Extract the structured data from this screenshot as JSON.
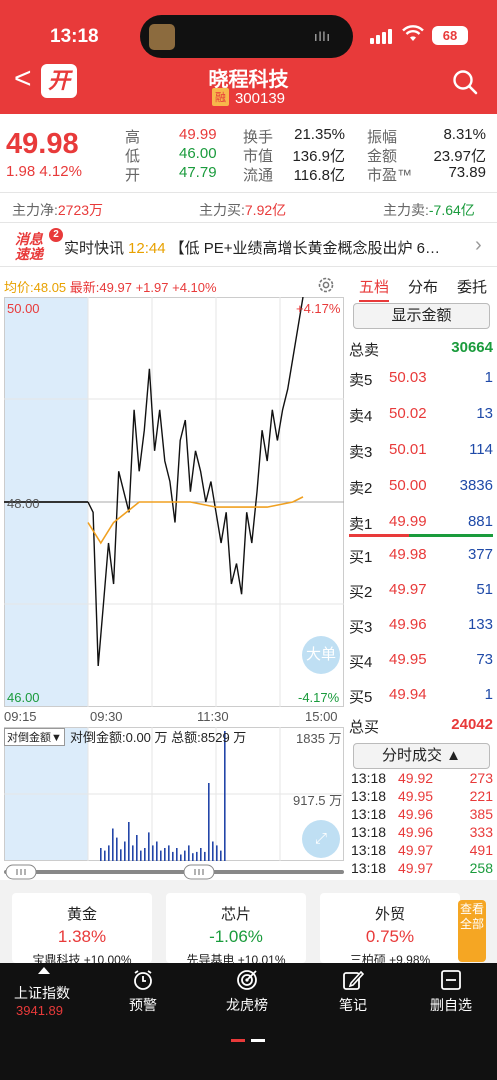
{
  "status": {
    "time": "13:18",
    "battery": "68"
  },
  "header": {
    "open_badge": "开",
    "title": "晓程科技",
    "badge": "融",
    "code": "300139"
  },
  "quote": {
    "price": "49.98",
    "change": "1.98",
    "change_pct": "4.12%",
    "high_label": "高",
    "high": "49.99",
    "low_label": "低",
    "low": "46.00",
    "open_label": "开",
    "open": "47.79",
    "turnover_label": "换手",
    "turnover": "21.35%",
    "mktcap_label": "市值",
    "mktcap": "136.9亿",
    "float_label": "流通",
    "float": "116.8亿",
    "amplitude_label": "振幅",
    "amplitude": "8.31%",
    "amount_label": "金额",
    "amount": "23.97亿",
    "pe_label": "市盈™",
    "pe": "73.89"
  },
  "flows": {
    "net_label": "主力净:",
    "net": "2723万",
    "buy_label": "主力买:",
    "buy": "7.92亿",
    "sell_label": "主力卖:",
    "sell": "-7.64亿"
  },
  "news": {
    "logo_top": "消息",
    "logo_bottom": "速递",
    "count": "2",
    "label": "实时快讯",
    "time": "12:44",
    "text": "【低 PE+业绩高增长黄金概念股出炉 6…"
  },
  "chart": {
    "avg_label": "均价:",
    "avg": "48.05",
    "latest_label": "最新:",
    "latest": "49.97",
    "latest_chg": "+1.97",
    "latest_pct": "+4.10%",
    "price_top": "50.00",
    "price_mid": "48.00",
    "price_bottom": "46.00",
    "pct_top": "+4.17%",
    "pct_bottom": "-4.17%",
    "time_labels": [
      "09:15",
      "09:30",
      "11:30",
      "15:00"
    ],
    "big_order_btn": "大单",
    "vol_tab": "对倒金额▼",
    "vol_info": "对倒金额:0.00 万 总额:8529 万",
    "vol_top": "1835 万",
    "vol_mid": "917.5 万"
  },
  "chart_data": {
    "type": "line",
    "x_range": [
      "09:15",
      "15:00"
    ],
    "ylim": [
      46.0,
      50.0
    ],
    "prev_close": 48.0,
    "series": [
      {
        "name": "最新",
        "color": "#111111",
        "points": [
          [
            0,
            48.0
          ],
          [
            0.02,
            47.9
          ],
          [
            0.04,
            46.4
          ],
          [
            0.06,
            47.0
          ],
          [
            0.08,
            47.6
          ],
          [
            0.1,
            47.2
          ],
          [
            0.12,
            48.3
          ],
          [
            0.14,
            48.1
          ],
          [
            0.16,
            47.9
          ],
          [
            0.18,
            48.9
          ],
          [
            0.2,
            48.3
          ],
          [
            0.22,
            48.7
          ],
          [
            0.24,
            49.3
          ],
          [
            0.26,
            48.5
          ],
          [
            0.28,
            48.9
          ],
          [
            0.3,
            48.4
          ],
          [
            0.32,
            48.2
          ],
          [
            0.34,
            47.8
          ],
          [
            0.36,
            48.6
          ],
          [
            0.38,
            48.8
          ],
          [
            0.4,
            48.1
          ],
          [
            0.42,
            48.5
          ],
          [
            0.44,
            48.3
          ],
          [
            0.46,
            48.0
          ],
          [
            0.48,
            48.2
          ],
          [
            0.5,
            47.9
          ],
          [
            0.52,
            47.6
          ],
          [
            0.54,
            47.9
          ],
          [
            0.56,
            47.2
          ],
          [
            0.58,
            47.4
          ],
          [
            0.6,
            47.1
          ],
          [
            0.62,
            47.9
          ],
          [
            0.64,
            47.6
          ],
          [
            0.66,
            48.1
          ],
          [
            0.68,
            48.7
          ],
          [
            0.7,
            48.4
          ],
          [
            0.72,
            48.9
          ],
          [
            0.74,
            48.6
          ],
          [
            0.76,
            48.9
          ],
          [
            0.78,
            49.1
          ],
          [
            0.8,
            49.4
          ],
          [
            0.82,
            49.7
          ],
          [
            0.84,
            50.0
          ]
        ]
      },
      {
        "name": "均价",
        "color": "#f0a020",
        "points": [
          [
            0,
            47.8
          ],
          [
            0.05,
            47.6
          ],
          [
            0.1,
            47.8
          ],
          [
            0.15,
            47.9
          ],
          [
            0.2,
            48.0
          ],
          [
            0.3,
            48.0
          ],
          [
            0.4,
            48.0
          ],
          [
            0.5,
            47.95
          ],
          [
            0.6,
            47.95
          ],
          [
            0.7,
            47.95
          ],
          [
            0.8,
            48.0
          ],
          [
            0.84,
            48.05
          ]
        ]
      }
    ],
    "volume": [
      0,
      0,
      0.1,
      0.08,
      0.12,
      0.25,
      0.18,
      0.09,
      0.15,
      0.3,
      0.12,
      0.2,
      0.08,
      0.1,
      0.22,
      0.12,
      0.15,
      0.08,
      0.1,
      0.12,
      0.07,
      0.1,
      0.05,
      0.08,
      0.12,
      0.06,
      0.07,
      0.1,
      0.07,
      0.6,
      0.15,
      0.12,
      0.08,
      1.0
    ]
  },
  "orderbook": {
    "tabs": [
      "五档",
      "分布",
      "委托"
    ],
    "show_amount_btn": "显示金额",
    "total_sell_label": "总卖",
    "total_sell": "30664",
    "asks": [
      {
        "name": "卖5",
        "price": "50.03",
        "vol": "1"
      },
      {
        "name": "卖4",
        "price": "50.02",
        "vol": "13"
      },
      {
        "name": "卖3",
        "price": "50.01",
        "vol": "114"
      },
      {
        "name": "卖2",
        "price": "50.00",
        "vol": "3836"
      },
      {
        "name": "卖1",
        "price": "49.99",
        "vol": "881"
      }
    ],
    "bids": [
      {
        "name": "买1",
        "price": "49.98",
        "vol": "377"
      },
      {
        "name": "买2",
        "price": "49.97",
        "vol": "51"
      },
      {
        "name": "买3",
        "price": "49.96",
        "vol": "133"
      },
      {
        "name": "买4",
        "price": "49.95",
        "vol": "73"
      },
      {
        "name": "买5",
        "price": "49.94",
        "vol": "1"
      }
    ],
    "total_buy_label": "总买",
    "total_buy": "24042",
    "deals_btn": "分时成交 ▲",
    "deals": [
      {
        "time": "13:18",
        "price": "49.92",
        "vol": "273",
        "dir": "up"
      },
      {
        "time": "13:18",
        "price": "49.95",
        "vol": "221",
        "dir": "up"
      },
      {
        "time": "13:18",
        "price": "49.96",
        "vol": "385",
        "dir": "up"
      },
      {
        "time": "13:18",
        "price": "49.96",
        "vol": "333",
        "dir": "up"
      },
      {
        "time": "13:18",
        "price": "49.97",
        "vol": "491",
        "dir": "up"
      },
      {
        "time": "13:18",
        "price": "49.97",
        "vol": "258",
        "dir": "down"
      }
    ]
  },
  "sectors": [
    {
      "name": "黄金",
      "pct": "1.38%",
      "stock": "宝鼎科技 +10.00%",
      "dir": "up"
    },
    {
      "name": "芯片",
      "pct": "-1.06%",
      "stock": "先导基电 +10.01%",
      "dir": "down"
    },
    {
      "name": "外贸",
      "pct": "0.75%",
      "stock": "三柏硕 +9.98%",
      "dir": "up"
    }
  ],
  "sectors_more": "查看全部",
  "bottom_bar": {
    "index_name": "上证指数",
    "index_value": "3941.89",
    "items": [
      {
        "label": "预警",
        "icon": "alarm-clock-icon"
      },
      {
        "label": "龙虎榜",
        "icon": "target-icon"
      },
      {
        "label": "笔记",
        "icon": "edit-icon"
      },
      {
        "label": "删自选",
        "icon": "minus-square-icon"
      }
    ]
  },
  "colors": {
    "accent": "#e83a3a",
    "down": "#1a9b3c",
    "avg_line": "#f0a020",
    "blue": "#1f4aa8"
  }
}
